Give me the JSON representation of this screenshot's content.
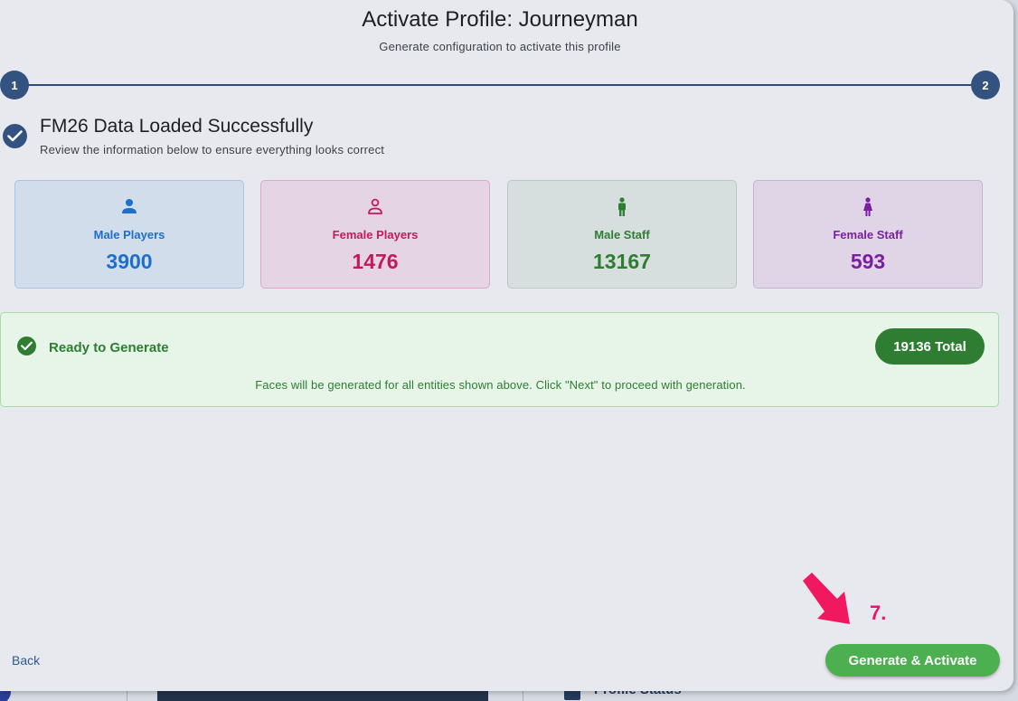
{
  "dialog": {
    "title": "Activate Profile: Journeyman",
    "subtitle": "Generate configuration to activate this profile"
  },
  "stepper": {
    "steps": [
      {
        "label": "1"
      },
      {
        "label": "2"
      }
    ]
  },
  "loaded": {
    "title": "FM26 Data Loaded Successfully",
    "subtitle": "Review the information below to ensure everything looks correct"
  },
  "cards": [
    {
      "label": "Male Players",
      "value": "3900",
      "icon": "person-icon",
      "color": "#1d6fcc"
    },
    {
      "label": "Female Players",
      "value": "1476",
      "icon": "person-outline-icon",
      "color": "#c4195e"
    },
    {
      "label": "Male Staff",
      "value": "13167",
      "icon": "man-icon",
      "color": "#2e7d32"
    },
    {
      "label": "Female Staff",
      "value": "593",
      "icon": "woman-icon",
      "color": "#7b1fa2"
    }
  ],
  "ready": {
    "title": "Ready to Generate",
    "total": "19136 Total",
    "note": "Faces will be generated for all entities shown above. Click \"Next\" to proceed with generation.",
    "color": "#2e7d32"
  },
  "footer": {
    "back_label": "Back",
    "generate_label": "Generate & Activate"
  },
  "annotation": {
    "step_label": "7.",
    "color": "#e6176a"
  },
  "background": {
    "status_label": "Profile Status"
  }
}
